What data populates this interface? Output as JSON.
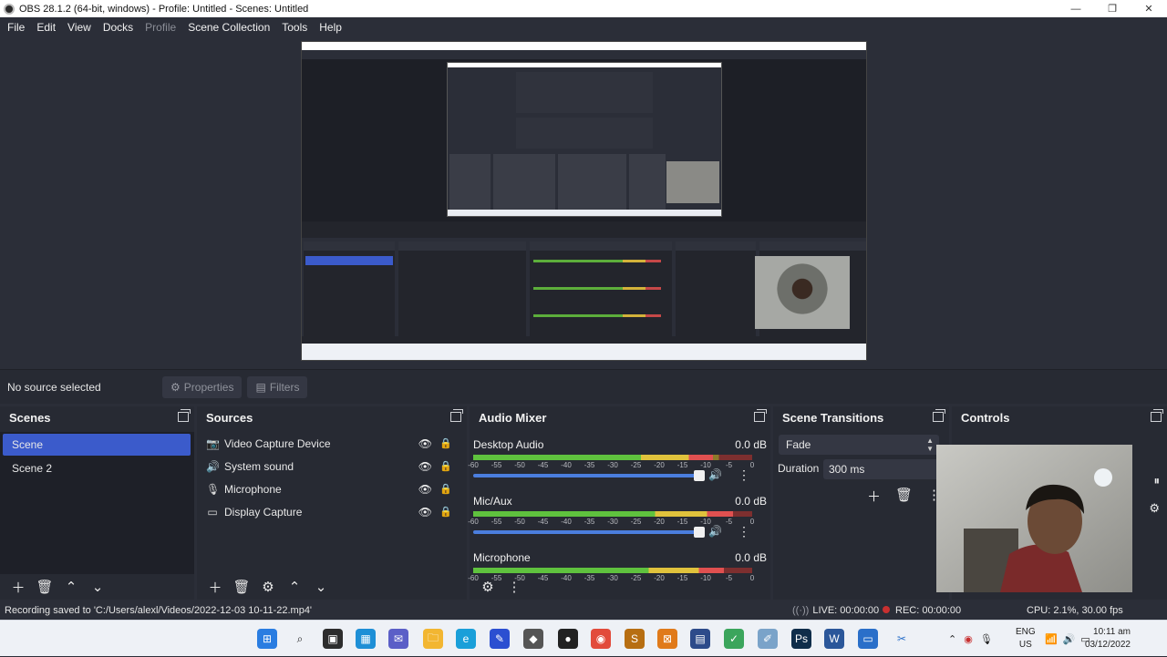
{
  "window": {
    "title": "OBS 28.1.2 (64-bit, windows) - Profile: Untitled - Scenes: Untitled",
    "controls": [
      "—",
      "❐",
      "✕"
    ]
  },
  "menu": [
    "File",
    "Edit",
    "View",
    "Docks",
    "Profile",
    "Scene Collection",
    "Tools",
    "Help"
  ],
  "context_bar": {
    "no_source": "No source selected",
    "properties": "Properties",
    "filters": "Filters"
  },
  "scenes": {
    "title": "Scenes",
    "items": [
      "Scene",
      "Scene 2"
    ],
    "active_index": 0
  },
  "sources": {
    "title": "Sources",
    "items": [
      {
        "label": "Video Capture Device",
        "icon": "camera-icon"
      },
      {
        "label": "System sound",
        "icon": "speaker-icon"
      },
      {
        "label": "Microphone",
        "icon": "microphone-icon"
      },
      {
        "label": "Display Capture",
        "icon": "monitor-icon"
      }
    ]
  },
  "audio_mixer": {
    "title": "Audio Mixer",
    "ticks": [
      "-60",
      "-55",
      "-50",
      "-45",
      "-40",
      "-35",
      "-30",
      "-25",
      "-20",
      "-15",
      "-10",
      "-5",
      "0"
    ],
    "channels": [
      {
        "name": "Desktop Audio",
        "db": "0.0 dB",
        "level": 0.86,
        "volume": 1.0
      },
      {
        "name": "Mic/Aux",
        "db": "0.0 dB",
        "level": 0.93,
        "volume": 1.0
      },
      {
        "name": "Microphone",
        "db": "0.0 dB",
        "level": 0.9,
        "volume": 1.0
      }
    ]
  },
  "transitions": {
    "title": "Scene Transitions",
    "selected": "Fade",
    "duration_label": "Duration",
    "duration_value": "300 ms"
  },
  "controls": {
    "title": "Controls"
  },
  "status": {
    "message": "Recording saved to 'C:/Users/alexl/Videos/2022-12-03 10-11-22.mp4'",
    "live": "LIVE: 00:00:00",
    "rec": "REC: 00:00:00",
    "cpu": "CPU: 2.1%, 30.00 fps"
  },
  "taskbar": {
    "lang_line1": "ENG",
    "lang_line2": "US",
    "time": "10:11 am",
    "date": "03/12/2022"
  },
  "colors": {
    "accent": "#3b5bcb",
    "panel": "#272a33",
    "background": "#2b2e38",
    "volume": "#4b7ede"
  }
}
